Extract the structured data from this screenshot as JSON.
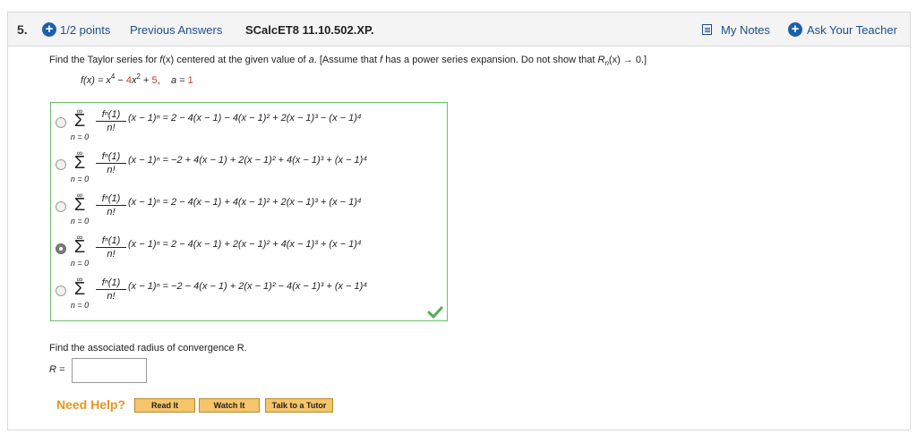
{
  "header": {
    "question_number": "5.",
    "points": "1/2 points",
    "previous_answers": "Previous Answers",
    "problem_id": "SCalcET8 11.10.502.XP.",
    "my_notes": "My Notes",
    "ask_teacher": "Ask Your Teacher",
    "accent_color": "#1d5fa8"
  },
  "question": {
    "prompt_a": "Find the Taylor series for ",
    "prompt_fx": "f",
    "prompt_b": "(x) centered at the given value of ",
    "prompt_avar": "a",
    "prompt_c": ". [Assume that ",
    "prompt_f2": "f",
    "prompt_d": " has a power series expansion. Do not show that ",
    "prompt_R": "R",
    "prompt_n": "n",
    "prompt_e": "(x) → 0.]",
    "function_lhs": "f(x) = x",
    "exp4": "4",
    "minus": " − ",
    "coef": "4",
    "x2": "x",
    "exp2": "2",
    "plus": " + ",
    "const": "5",
    "comma": ",",
    "a_eq": "a = ",
    "a_val": "1"
  },
  "answers": {
    "sum_upper": "∞",
    "sum_symbol": "Σ",
    "sum_lower": "n = 0",
    "frac_num": "fⁿ(1)",
    "frac_den": "n!",
    "options": [
      {
        "selected": false,
        "expr": "(x − 1)ⁿ = 2 − 4(x − 1) − 4(x − 1)² + 2(x − 1)³ − (x − 1)⁴"
      },
      {
        "selected": false,
        "expr": "(x − 1)ⁿ = −2 + 4(x − 1) + 2(x − 1)² + 4(x − 1)³ + (x − 1)⁴"
      },
      {
        "selected": false,
        "expr": "(x − 1)ⁿ = 2 − 4(x − 1) + 4(x − 1)² + 2(x − 1)³ + (x − 1)⁴"
      },
      {
        "selected": true,
        "expr": "(x − 1)ⁿ = 2 − 4(x − 1) + 2(x − 1)² + 4(x − 1)³ + (x − 1)⁴"
      },
      {
        "selected": false,
        "expr": "(x − 1)ⁿ = −2 − 4(x − 1) + 2(x − 1)² − 4(x − 1)³ + (x − 1)⁴"
      }
    ],
    "status_color": "#4caf50"
  },
  "radius": {
    "prompt": "Find the associated radius of convergence R.",
    "label": "R =",
    "value": ""
  },
  "help": {
    "need_help": "Need Help?",
    "read_it": "Read It",
    "watch_it": "Watch It",
    "talk_to_tutor": "Talk to a Tutor"
  }
}
